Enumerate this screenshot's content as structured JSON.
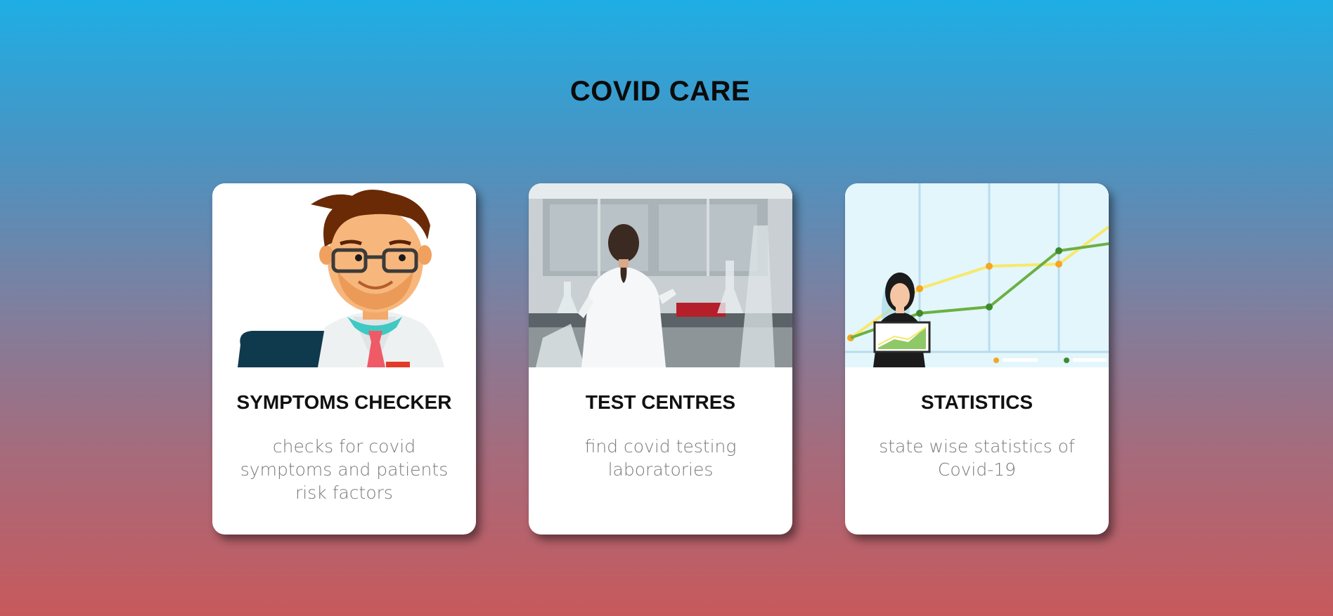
{
  "header": {
    "title": "COVID CARE"
  },
  "cards": [
    {
      "title": "SYMPTOMS CHECKER",
      "description": "checks for covid symptoms and patients risk factors",
      "image": "doctor-illustration"
    },
    {
      "title": "TEST CENTRES",
      "description": "find covid testing laboratories",
      "image": "laboratory-photo"
    },
    {
      "title": "STATISTICS",
      "description": "state wise statistics of Covid-19",
      "image": "statistics-illustration"
    }
  ],
  "colors": {
    "gradient_top": "#1eaee4",
    "gradient_bottom": "#c7595c",
    "card_background": "#ffffff",
    "title_text": "#111111",
    "description_text": "#7a7a7a"
  }
}
